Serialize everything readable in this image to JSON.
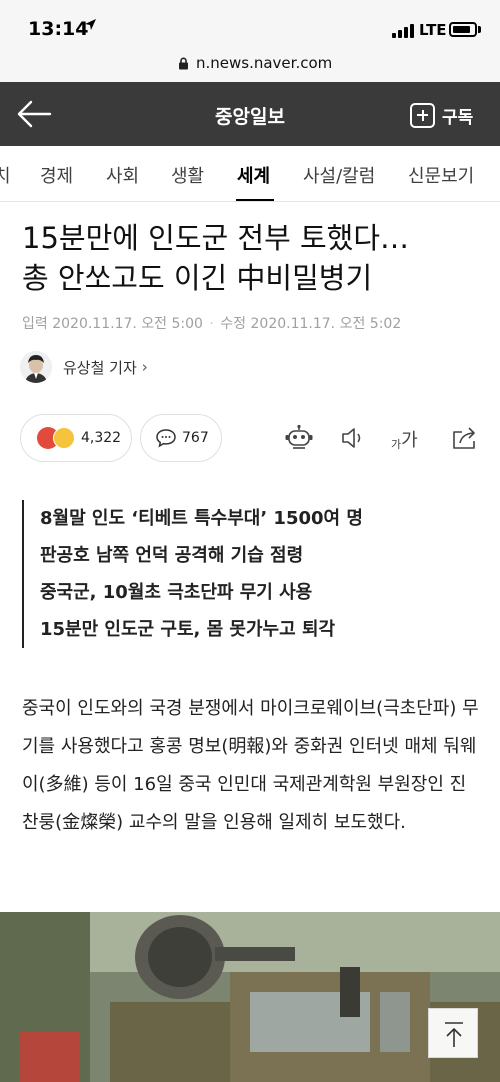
{
  "status_bar": {
    "time": "13:14",
    "network": "LTE"
  },
  "browser": {
    "url": "n.news.naver.com"
  },
  "header": {
    "title": "중앙일보",
    "subscribe_label": "구독"
  },
  "tabs": [
    {
      "label": "치"
    },
    {
      "label": "경제"
    },
    {
      "label": "사회"
    },
    {
      "label": "생활"
    },
    {
      "label": "세계",
      "active": true
    },
    {
      "label": "사설/칼럼"
    },
    {
      "label": "신문보기"
    }
  ],
  "article": {
    "headline_line1": "15분만에 인도군 전부 토했다…",
    "headline_line2": "총 안쏘고도 이긴 中비밀병기",
    "meta": {
      "input_label": "입력",
      "input_time": "2020.11.17. 오전 5:00",
      "modified_label": "수정",
      "modified_time": "2020.11.17. 오전 5:02"
    },
    "byline": "유상철 기자",
    "reactions": {
      "count": "4,322"
    },
    "comments": {
      "count": "767"
    },
    "font_icon_small": "가",
    "font_icon_big": "가",
    "summary": [
      "8월말 인도 ‘티베트 특수부대’ 1500여 명",
      "판공호 남쪽 언덕 공격해 기습 점령",
      "중국군, 10월초 극초단파 무기 사용",
      "15분만 인도군 구토, 몸 못가누고 퇴각"
    ],
    "body": "중국이 인도와의 국경 분쟁에서 마이크로웨이브(극초단파) 무기를 사용했다고 홍콩 명보(明報)와 중화권 인터넷 매체 둬웨이(多維) 등이 16일 중국 인민대 국제관계학원 부원장인 진찬룽(金燦榮) 교수의 말을 인용해 일제히 보도했다."
  },
  "colors": {
    "header_bg": "#3a3a3a",
    "status_bg": "#f6f6f6",
    "angry": "#e24b3b",
    "smile": "#f6c33c"
  }
}
